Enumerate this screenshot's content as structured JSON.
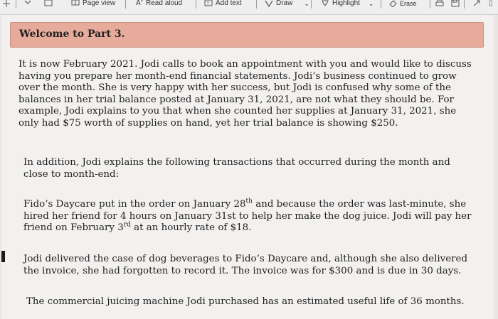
{
  "toolbar": {
    "page_view": "Page view",
    "read_aloud": "Read aloud",
    "add_text": "Add text",
    "draw": "Draw",
    "highlight": "Highlight",
    "erase": "Erase"
  },
  "banner": {
    "title": "Welcome to Part 3."
  },
  "paragraphs": {
    "p1": "It is now February 2021. Jodi calls to book an appointment with you and would like to discuss having you prepare her month-end financial statements. Jodi’s business continued to grow over the month. She is very happy with her success, but Jodi is confused why some of the balances in her trial balance posted at January 31, 2021, are not what they should be. For example, Jodi explains to you that when she counted her supplies at January 31, 2021, she only had $75 worth of supplies on hand, yet her trial balance is showing $250.",
    "p2": "In addition, Jodi explains the following transactions that occurred during the month and close to month-end:",
    "p3": {
      "a": "Fido’s Daycare put in the order on January 28",
      "sup1": "th",
      "b": " and because the order was last-minute, she hired her friend for 4 hours on January 31st to help her make the dog juice. Jodi will pay her friend on February 3",
      "sup2": "rd",
      "c": " at an hourly rate of $18."
    },
    "p4": "Jodi delivered the case of dog beverages to Fido’s Daycare and, although she also delivered the invoice, she had forgotten to record it. The invoice was for $300 and is due in 30 days.",
    "p5": "The commercial juicing machine Jodi purchased has an estimated useful life of 36 months."
  }
}
